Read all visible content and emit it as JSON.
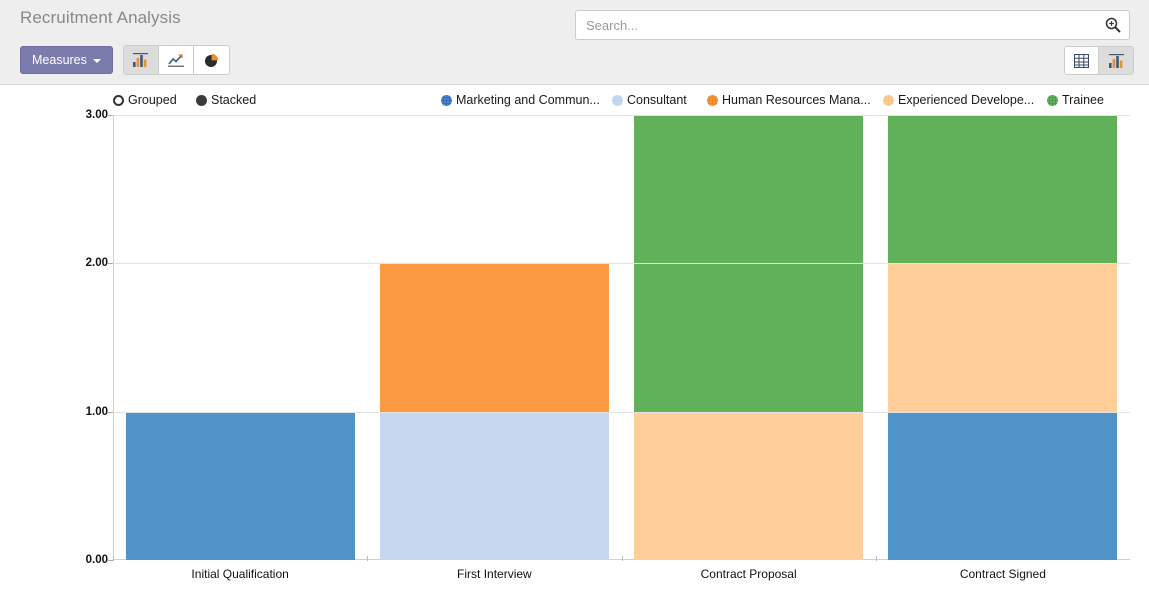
{
  "header": {
    "title": "Recruitment Analysis",
    "measures_label": "Measures",
    "chart_buttons": [
      {
        "name": "bar-chart-button",
        "icon": "bar-chart-icon",
        "active": true
      },
      {
        "name": "line-chart-button",
        "icon": "line-chart-icon",
        "active": false
      },
      {
        "name": "pie-chart-button",
        "icon": "pie-chart-icon",
        "active": false
      }
    ],
    "view_switcher": [
      {
        "name": "pivot-view-button",
        "icon": "table-icon",
        "active": false
      },
      {
        "name": "graph-view-button",
        "icon": "bar-chart-icon",
        "active": true
      }
    ]
  },
  "search": {
    "placeholder": "Search...",
    "value": "",
    "icon": "search-plus-icon"
  },
  "mode_toggles": [
    {
      "label": "Grouped",
      "selected": false
    },
    {
      "label": "Stacked",
      "selected": true
    }
  ],
  "chart_data": {
    "type": "bar",
    "stacked": true,
    "title": "Recruitment Analysis",
    "xlabel": "",
    "ylabel": "",
    "ylim": [
      0,
      3
    ],
    "yticks": [
      "0.00",
      "1.00",
      "2.00",
      "3.00"
    ],
    "grid": true,
    "legend_position": "top",
    "categories": [
      "Initial Qualification",
      "First Interview",
      "Contract Proposal",
      "Contract Signed"
    ],
    "series": [
      {
        "name": "Marketing and Commun...",
        "color": "#4f93c8",
        "legend_color": "#2f6fbf",
        "values": [
          1,
          0,
          0,
          1
        ]
      },
      {
        "name": "Consultant",
        "color": "#c5d8f0",
        "legend_color": "#bcd3ee",
        "values": [
          0,
          1,
          0,
          0
        ]
      },
      {
        "name": "Human Resources Mana...",
        "color": "#fb9a42",
        "legend_color": "#f0881f",
        "values": [
          0,
          1,
          0,
          0
        ]
      },
      {
        "name": "Experienced Develope...",
        "color": "#ffce99",
        "legend_color": "#fcc484",
        "values": [
          0,
          0,
          1,
          1
        ]
      },
      {
        "name": "Trainee",
        "color": "#60b15a",
        "legend_color": "#49a047",
        "values": [
          0,
          0,
          2,
          1
        ]
      }
    ],
    "totals": [
      1,
      2,
      3,
      3
    ]
  }
}
